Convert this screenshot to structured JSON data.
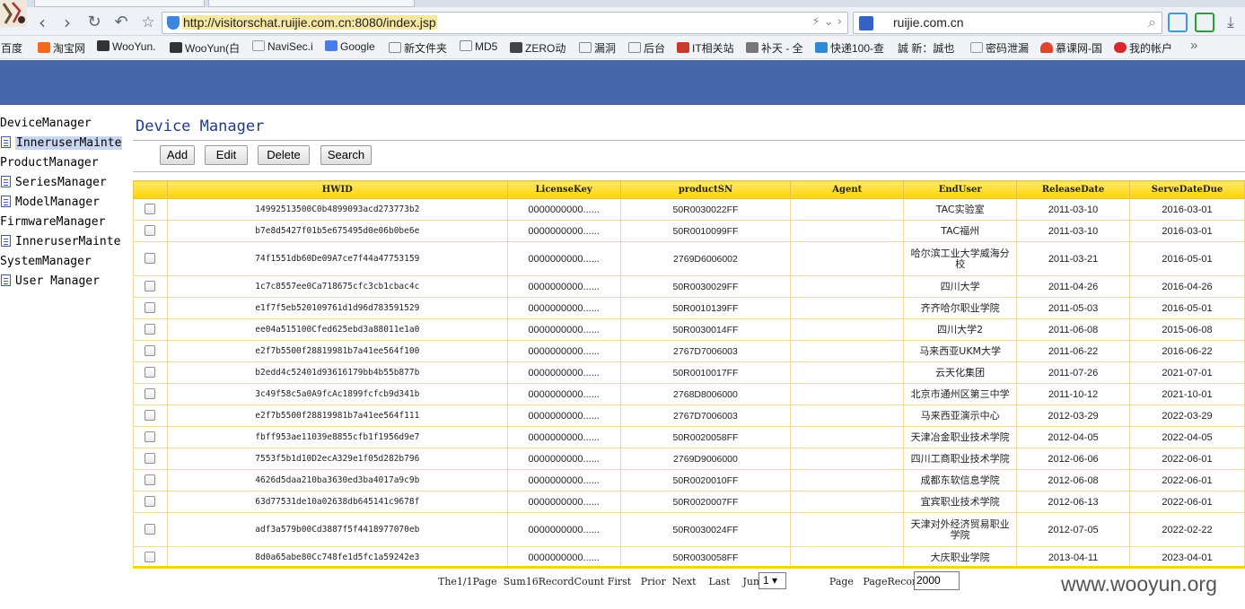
{
  "browser": {
    "url": "http://visitorschat.ruijie.com.cn:8080/index.jsp",
    "search_text": "ruijie.com.cn",
    "bookmarks": [
      "百度",
      "淘宝网",
      "WooYun.",
      "WooYun(白",
      "NaviSec.i",
      "Google",
      "新文件夹",
      "MD5",
      "ZERO动",
      "漏洞",
      "后台",
      "IT相关站",
      "补天 - 全",
      "快递100-查",
      "誠 新：誠也",
      "密码泄漏",
      "慕课网-国",
      "我的帐户"
    ],
    "bookmarks_more": "»"
  },
  "sidebar": {
    "items": [
      {
        "label": "DeviceManager",
        "type": "folder"
      },
      {
        "label": "InneruserMainte",
        "type": "leaf",
        "selected": true
      },
      {
        "label": "ProductManager",
        "type": "folder"
      },
      {
        "label": "SeriesManager",
        "type": "leaf"
      },
      {
        "label": "ModelManager",
        "type": "leaf"
      },
      {
        "label": "FirmwareManager",
        "type": "folder"
      },
      {
        "label": "InneruserMainte",
        "type": "leaf"
      },
      {
        "label": "SystemManager",
        "type": "folder"
      },
      {
        "label": "User Manager",
        "type": "leaf"
      }
    ]
  },
  "page": {
    "title": "Device Manager",
    "buttons": {
      "add": "Add",
      "edit": "Edit",
      "delete": "Delete",
      "search": "Search"
    }
  },
  "table": {
    "headers": [
      "HWID",
      "LicenseKey",
      "productSN",
      "Agent",
      "EndUser",
      "ReleaseDate",
      "ServeDateDue"
    ],
    "rows": [
      [
        "14992513500C0b4899093acd273773b2",
        "0000000000......",
        "50R0030022FF",
        "",
        "TAC实验室",
        "2011-03-10",
        "2016-03-01"
      ],
      [
        "b7e8d5427f01b5e675495d0e06b0be6e",
        "0000000000......",
        "50R0010099FF",
        "",
        "TAC福州",
        "2011-03-10",
        "2016-03-01"
      ],
      [
        "74f1551db60De09A7ce7f44a47753159",
        "0000000000......",
        "2769D6006002",
        "",
        "哈尔滨工业大学威海分校",
        "2011-03-21",
        "2016-05-01"
      ],
      [
        "1c7c8557ee0Ca718675cfc3cb1cbac4c",
        "0000000000......",
        "50R0030029FF",
        "",
        "四川大学",
        "2011-04-26",
        "2016-04-26"
      ],
      [
        "e1f7f5eb520109761d1d96d783591529",
        "0000000000......",
        "50R0010139FF",
        "",
        "齐齐哈尔职业学院",
        "2011-05-03",
        "2016-05-01"
      ],
      [
        "ee04a515100Cfed625ebd3a88011e1a0",
        "0000000000......",
        "50R0030014FF",
        "",
        "四川大学2",
        "2011-06-08",
        "2015-06-08"
      ],
      [
        "e2f7b5500f28819981b7a41ee564f100",
        "0000000000......",
        "2767D7006003",
        "",
        "马来西亚UKM大学",
        "2011-06-22",
        "2016-06-22"
      ],
      [
        "b2edd4c52401d93616179bb4b55b877b",
        "0000000000......",
        "50R0010017FF",
        "",
        "云天化集团",
        "2011-07-26",
        "2021-07-01"
      ],
      [
        "3c49f58c5a0A9fcAc1899fcfcb9d341b",
        "0000000000......",
        "2768D8006000",
        "",
        "北京市通州区第三中学",
        "2011-10-12",
        "2021-10-01"
      ],
      [
        "e2f7b5500f28819981b7a41ee564f111",
        "0000000000......",
        "2767D7006003",
        "",
        "马来西亚演示中心",
        "2012-03-29",
        "2022-03-29"
      ],
      [
        "fbff953ae11039e8855cfb1f1956d9e7",
        "0000000000......",
        "50R0020058FF",
        "",
        "天津冶金职业技术学院",
        "2012-04-05",
        "2022-04-05"
      ],
      [
        "7553f5b1d10D2ecA329e1f05d282b796",
        "0000000000......",
        "2769D9006000",
        "",
        "四川工商职业技术学院",
        "2012-06-06",
        "2022-06-01"
      ],
      [
        "4626d5daa210ba3630ed3ba4017a9c9b",
        "0000000000......",
        "50R0020010FF",
        "",
        "成都东软信息学院",
        "2012-06-08",
        "2022-06-01"
      ],
      [
        "63d77531de10a02638db645141c9678f",
        "0000000000......",
        "50R0020007FF",
        "",
        "宜宾职业技术学院",
        "2012-06-13",
        "2022-06-01"
      ],
      [
        "adf3a579b00Cd3887f5f4418977070eb",
        "0000000000......",
        "50R0030024FF",
        "",
        "天津对外经济贸易职业学院",
        "2012-07-05",
        "2022-02-22"
      ],
      [
        "8d0a65abe80Cc748fe1d5fc1a59242e3",
        "0000000000......",
        "50R0030058FF",
        "",
        "大庆职业学院",
        "2013-04-11",
        "2023-04-01"
      ]
    ]
  },
  "pager": {
    "info": "The1/1Page  Sum16RecordCount",
    "first": "First",
    "prior": "Prior",
    "next": "Next",
    "last": "Last",
    "jump_label": "Jump",
    "jump_value": "1 ▾",
    "page_label": "Page",
    "record_count_label": "PageRecordCount",
    "record_count_value": "2000"
  },
  "watermark": "www.wooyun.org"
}
